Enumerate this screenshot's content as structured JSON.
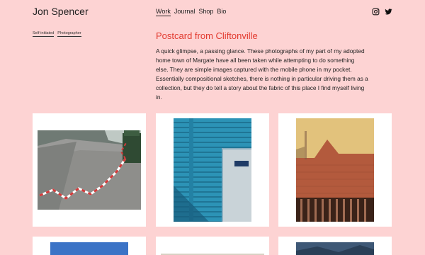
{
  "header": {
    "site_title": "Jon Spencer",
    "nav": [
      "Work",
      "Journal",
      "Shop",
      "Bio"
    ],
    "active_nav": "Work",
    "social_icons": [
      "instagram-icon",
      "twitter-icon"
    ]
  },
  "tags": [
    "Self-initiated",
    "Photographer"
  ],
  "post": {
    "title": "Postcard from Cliftonville",
    "body": "A quick glimpse, a passing glance. These photographs of my part of my adopted home town of Margate have all been taken while attempting to do something else. They are simple images captured with the mobile phone in my pocket. Essentially compositional sketches, there is nothing in particular driving them as a collection, but they do tell a story about the fabric of this place I find myself living in."
  },
  "colors": {
    "background": "#fdd3d3",
    "accent": "#e23a2f"
  },
  "gallery": [
    {
      "name": "photo-street-tape"
    },
    {
      "name": "photo-blue-shutter"
    },
    {
      "name": "photo-brick-wall-fence"
    },
    {
      "name": "photo-sky"
    },
    {
      "name": "photo-pale-wall"
    },
    {
      "name": "photo-dark-sky"
    }
  ]
}
